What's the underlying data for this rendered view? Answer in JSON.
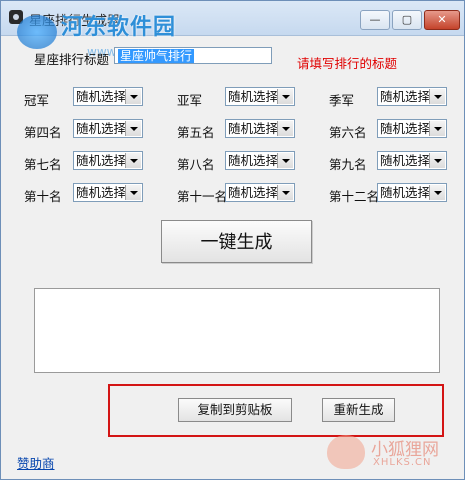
{
  "window": {
    "title": "星座排行生成器",
    "controls": {
      "minimize": "—",
      "maximize": "▢",
      "close": "✕"
    }
  },
  "watermark": {
    "logo_text": "河东软件园",
    "url_text": "www.pc0359.cn",
    "corner_cn": "小狐狸网",
    "corner_en": "XHLKS.CN"
  },
  "form": {
    "title_label": "星座排行标题",
    "title_value": "星座帅气排行",
    "title_hint": "请填写排行的标题"
  },
  "ranks": [
    {
      "label": "冠军",
      "value": "随机选择"
    },
    {
      "label": "亚军",
      "value": "随机选择"
    },
    {
      "label": "季军",
      "value": "随机选择"
    },
    {
      "label": "第四名",
      "value": "随机选择"
    },
    {
      "label": "第五名",
      "value": "随机选择"
    },
    {
      "label": "第六名",
      "value": "随机选择"
    },
    {
      "label": "第七名",
      "value": "随机选择"
    },
    {
      "label": "第八名",
      "value": "随机选择"
    },
    {
      "label": "第九名",
      "value": "随机选择"
    },
    {
      "label": "第十名",
      "value": "随机选择"
    },
    {
      "label": "第十一名",
      "value": "随机选择"
    },
    {
      "label": "第十二名",
      "value": "随机选择"
    }
  ],
  "actions": {
    "generate": "一键生成",
    "copy": "复制到剪贴板",
    "regenerate": "重新生成",
    "sponsor": "赞助商"
  },
  "output_text": ""
}
